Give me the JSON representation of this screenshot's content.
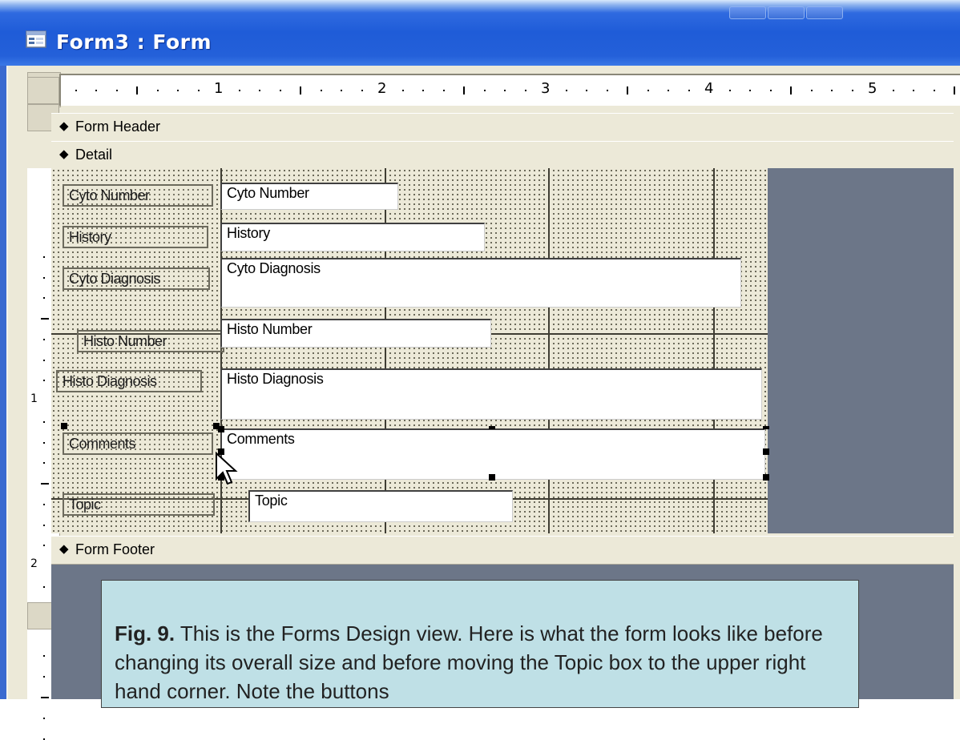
{
  "window": {
    "title": "Form3 : Form"
  },
  "ruler": {
    "marks": [
      "1",
      "2",
      "3",
      "4",
      "5"
    ],
    "vertical_marks": [
      "1",
      "2"
    ]
  },
  "sections": {
    "form_header": "Form Header",
    "detail": "Detail",
    "form_footer": "Form Footer"
  },
  "controls": [
    {
      "label": "Cyto Number",
      "field": "Cyto Number"
    },
    {
      "label": "History",
      "field": "History"
    },
    {
      "label": "Cyto Diagnosis",
      "field": "Cyto Diagnosis"
    },
    {
      "label": "Histo Number",
      "field": "Histo Number"
    },
    {
      "label": "Histo Diagnosis",
      "field": "Histo Diagnosis"
    },
    {
      "label": "Comments",
      "field": "Comments"
    },
    {
      "label": "Topic",
      "field": "Topic"
    }
  ],
  "caption": {
    "fig_label": "Fig. 9.",
    "text": "This is the Forms Design view. Here is what the form looks like before changing its overall size and before moving the Topic box to the upper right hand corner. Note the buttons"
  },
  "colors": {
    "titlebar": "#2460d9",
    "workspace": "#6c7688",
    "grid": "#ece9d8",
    "caption_bg": "#bfe0e6"
  }
}
